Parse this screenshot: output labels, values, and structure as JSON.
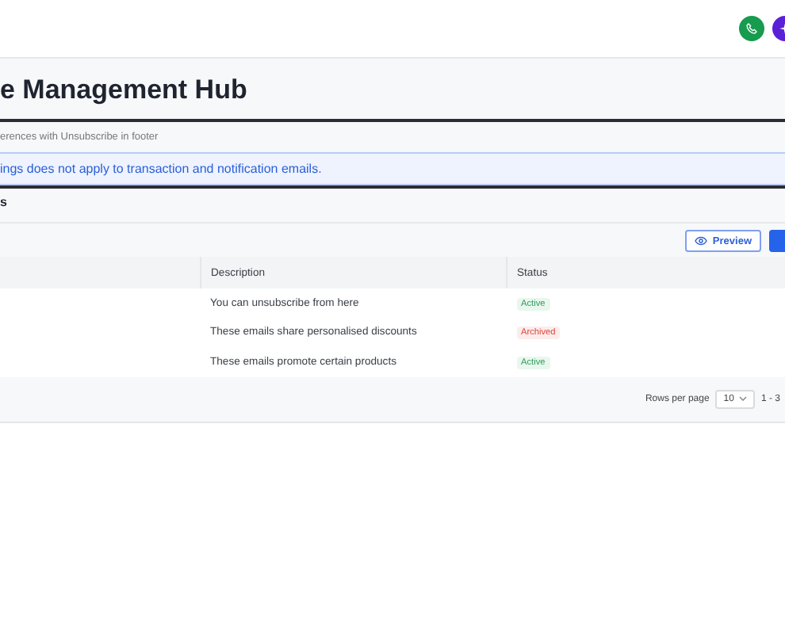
{
  "header": {
    "title": "e Management Hub"
  },
  "subtitle": "erences with Unsubscribe in footer",
  "banner": "ings does not apply to transaction and notification emails.",
  "section": "s",
  "toolbar": {
    "preview": "Preview"
  },
  "table": {
    "columns": [
      "Description",
      "Status"
    ],
    "rows": [
      {
        "description": "You can unsubscribe from here",
        "status": {
          "label": "Active",
          "kind": "success"
        }
      },
      {
        "description": "These emails share personalised discounts",
        "status": {
          "label": "Archived",
          "kind": "danger"
        }
      },
      {
        "description": "These emails promote certain products",
        "status": {
          "label": "Active",
          "kind": "success"
        }
      }
    ]
  },
  "pagination": {
    "rows_label": "Rows per page",
    "page_size": "10",
    "range": "1 - 3"
  }
}
